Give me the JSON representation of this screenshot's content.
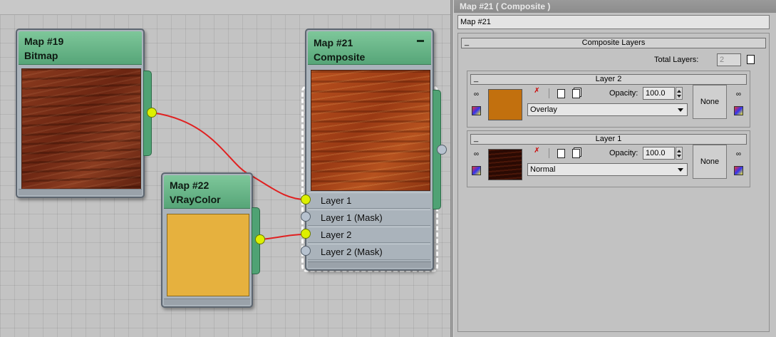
{
  "nodes": {
    "map19": {
      "id": "Map #19",
      "type": "Bitmap"
    },
    "map22": {
      "id": "Map #22",
      "type": "VRayColor",
      "color": "#e6b13e"
    },
    "map21": {
      "id": "Map #21",
      "type": "Composite",
      "slots": [
        {
          "label": "Layer 1",
          "connected": true
        },
        {
          "label": "Layer 1 (Mask)",
          "connected": false
        },
        {
          "label": "Layer 2",
          "connected": true
        },
        {
          "label": "Layer 2 (Mask)",
          "connected": false
        }
      ]
    }
  },
  "colors": {
    "header": "#5fae80",
    "wire": "#e02020",
    "socket_live": "#ddf000",
    "socket_dead": "#b7c2cf"
  },
  "panel": {
    "title": "Map #21  ( Composite )",
    "name_value": "Map #21",
    "composite_rollout": "Composite Layers",
    "total_layers_label": "Total Layers:",
    "total_layers_value": "2",
    "layers": [
      {
        "title": "Layer 2",
        "opacity_label": "Opacity:",
        "opacity": "100.0",
        "blend_mode": "Overlay",
        "mask_label": "None",
        "swatch_color": "#c2700e"
      },
      {
        "title": "Layer 1",
        "opacity_label": "Opacity:",
        "opacity": "100.0",
        "blend_mode": "Normal",
        "mask_label": "None",
        "swatch_color": "#3a0f06"
      }
    ]
  }
}
